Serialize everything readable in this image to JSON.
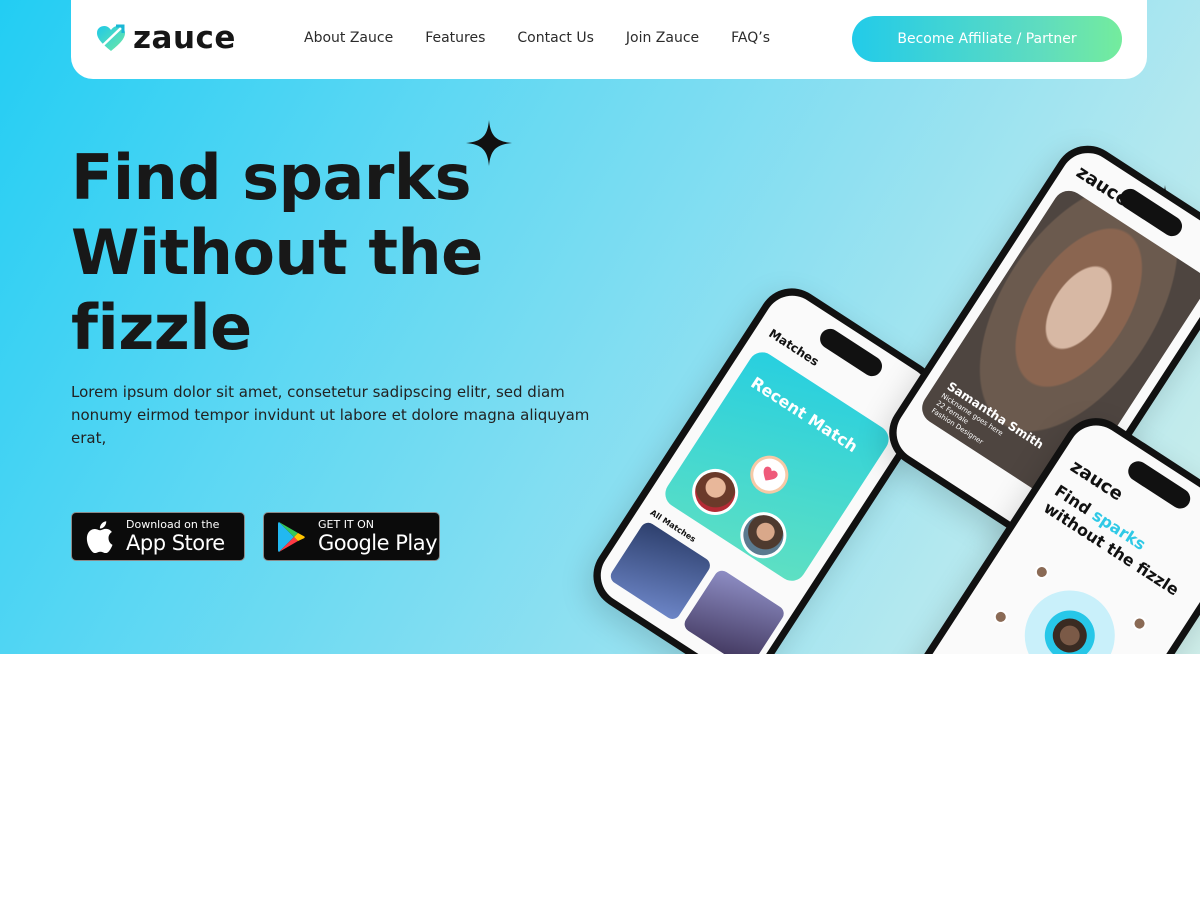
{
  "brand": {
    "name": "zauce"
  },
  "nav": {
    "links": [
      "About Zauce",
      "Features",
      "Contact Us",
      "Join Zauce",
      "FAQ’s"
    ],
    "cta": "Become Affiliate / Partner"
  },
  "hero": {
    "headline": [
      "Find sparks",
      "Without the",
      "fizzle"
    ],
    "lead": "Lorem ipsum dolor sit amet, consetetur sadipscing elitr, sed diam nonumy eirmod tempor invidunt ut labore et dolore magna aliquyam erat,"
  },
  "stores": {
    "apple": {
      "small": "Download on the",
      "big": "App Store"
    },
    "google": {
      "small": "GET IT ON",
      "big": "Google Play"
    }
  },
  "phones": {
    "matches": {
      "title": "Matches",
      "card_label": "Recent Match",
      "all_label": "All Matches"
    },
    "profile": {
      "logo": "zauce",
      "name": "Samantha Smith",
      "meta": [
        "Nickname goes here",
        "22  Female",
        "Fashion Designer"
      ]
    },
    "splash": {
      "logo": "zauce",
      "tagline_1": "Find ",
      "tagline_accent": "sparks",
      "tagline_2": "without the fizzle"
    }
  },
  "colors": {
    "accent": "#22cdf3",
    "cta_start": "#22cbe9",
    "cta_end": "#74ec9d",
    "heading": "#181818"
  }
}
